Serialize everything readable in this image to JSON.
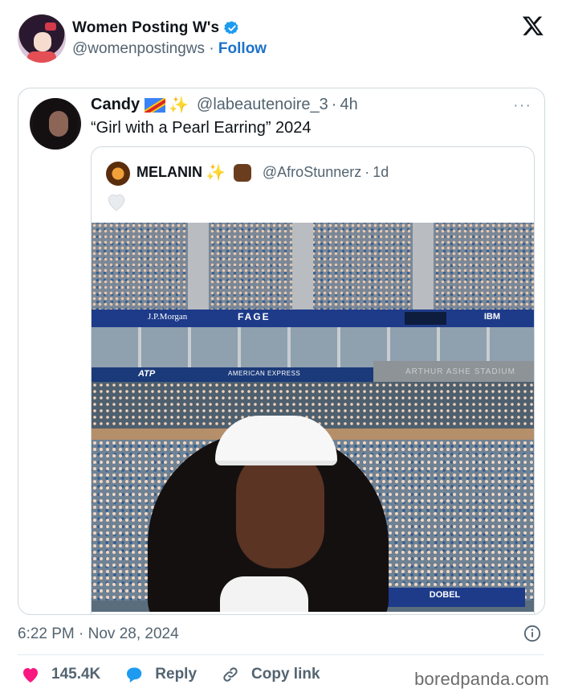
{
  "author": {
    "display_name": "Women Posting W's",
    "handle": "@womenpostingws",
    "separator": "·",
    "follow_label": "Follow",
    "verified": true
  },
  "quoted_post": {
    "name": "Candy",
    "handle": "@labeautenoire_3",
    "time": "4h",
    "separator": "·",
    "text": "“Girl with a Pearl Earring” 2024",
    "more_label": "···",
    "inner_post": {
      "name": "MELANIN",
      "handle": "@AfroStunnerz",
      "time": "1d",
      "separator": "·",
      "photo": {
        "banner_jpmorgan": "J.P.Morgan",
        "banner_fage": "FAGE",
        "banner_ibm": "IBM",
        "banner_atp": "ATP",
        "banner_amex": "AMERICAN EXPRESS",
        "stadium_sign": "ARTHUR ASHE STADIUM",
        "banner_dobel": "DOBEL"
      }
    }
  },
  "footer": {
    "timestamp": "6:22 PM · Nov 28, 2024",
    "likes": "145.4K",
    "reply_label": "Reply",
    "copy_link_label": "Copy link",
    "watermark": "boredpanda.com"
  },
  "colors": {
    "accent": "#1d72c9",
    "like": "#f91880",
    "reply": "#1d9bf0",
    "muted": "#536471"
  }
}
